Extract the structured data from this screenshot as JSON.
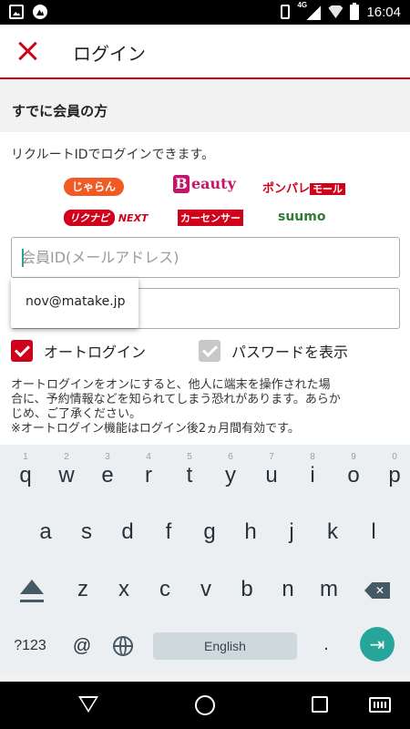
{
  "status_bar": {
    "network": "4G",
    "time": "16:04"
  },
  "header": {
    "title": "ログイン"
  },
  "section": {
    "title": "すでに会員の方"
  },
  "login": {
    "lead": "リクルートIDでログインできます。",
    "logos": {
      "jalan": "じゃらん",
      "beauty_b": "B",
      "beauty": "eauty",
      "ponpare": "ポンパレ",
      "ponpare_tag": "モール",
      "rikunabi": "リクナビ",
      "rikunabi_next": "NEXT",
      "carsensor": "カーセンサー",
      "suumo": "suumo"
    },
    "id_placeholder": "会員ID(メールアドレス)",
    "password_placeholder": "",
    "autocomplete_suggestion": "nov@matake.jp",
    "auto_login_label": "オートログイン",
    "auto_login_checked": true,
    "show_password_label": "パスワードを表示",
    "show_password_checked": false,
    "note": "オートログインをオンにすると、他人に端末を操作された場\n合に、予約情報などを知られてしまう恐れがあります。あらか\nじめ、ご了承ください。\n※オートログイン機能はログイン後2ヵ月間有効です。"
  },
  "keyboard": {
    "row1": [
      "q",
      "w",
      "e",
      "r",
      "t",
      "y",
      "u",
      "i",
      "o",
      "p"
    ],
    "row1_hints": [
      "1",
      "2",
      "3",
      "4",
      "5",
      "6",
      "7",
      "8",
      "9",
      "0"
    ],
    "row2": [
      "a",
      "s",
      "d",
      "f",
      "g",
      "h",
      "j",
      "k",
      "l"
    ],
    "row3": [
      "z",
      "x",
      "c",
      "v",
      "b",
      "n",
      "m"
    ],
    "symbols_label": "?123",
    "at_label": "@",
    "space_label": "English",
    "period_label": ".",
    "enter_icon": "next-arrow-icon"
  },
  "colors": {
    "accent": "#d0021b",
    "keyboard_bg": "#eceff1",
    "enter_key": "#26a69a"
  }
}
